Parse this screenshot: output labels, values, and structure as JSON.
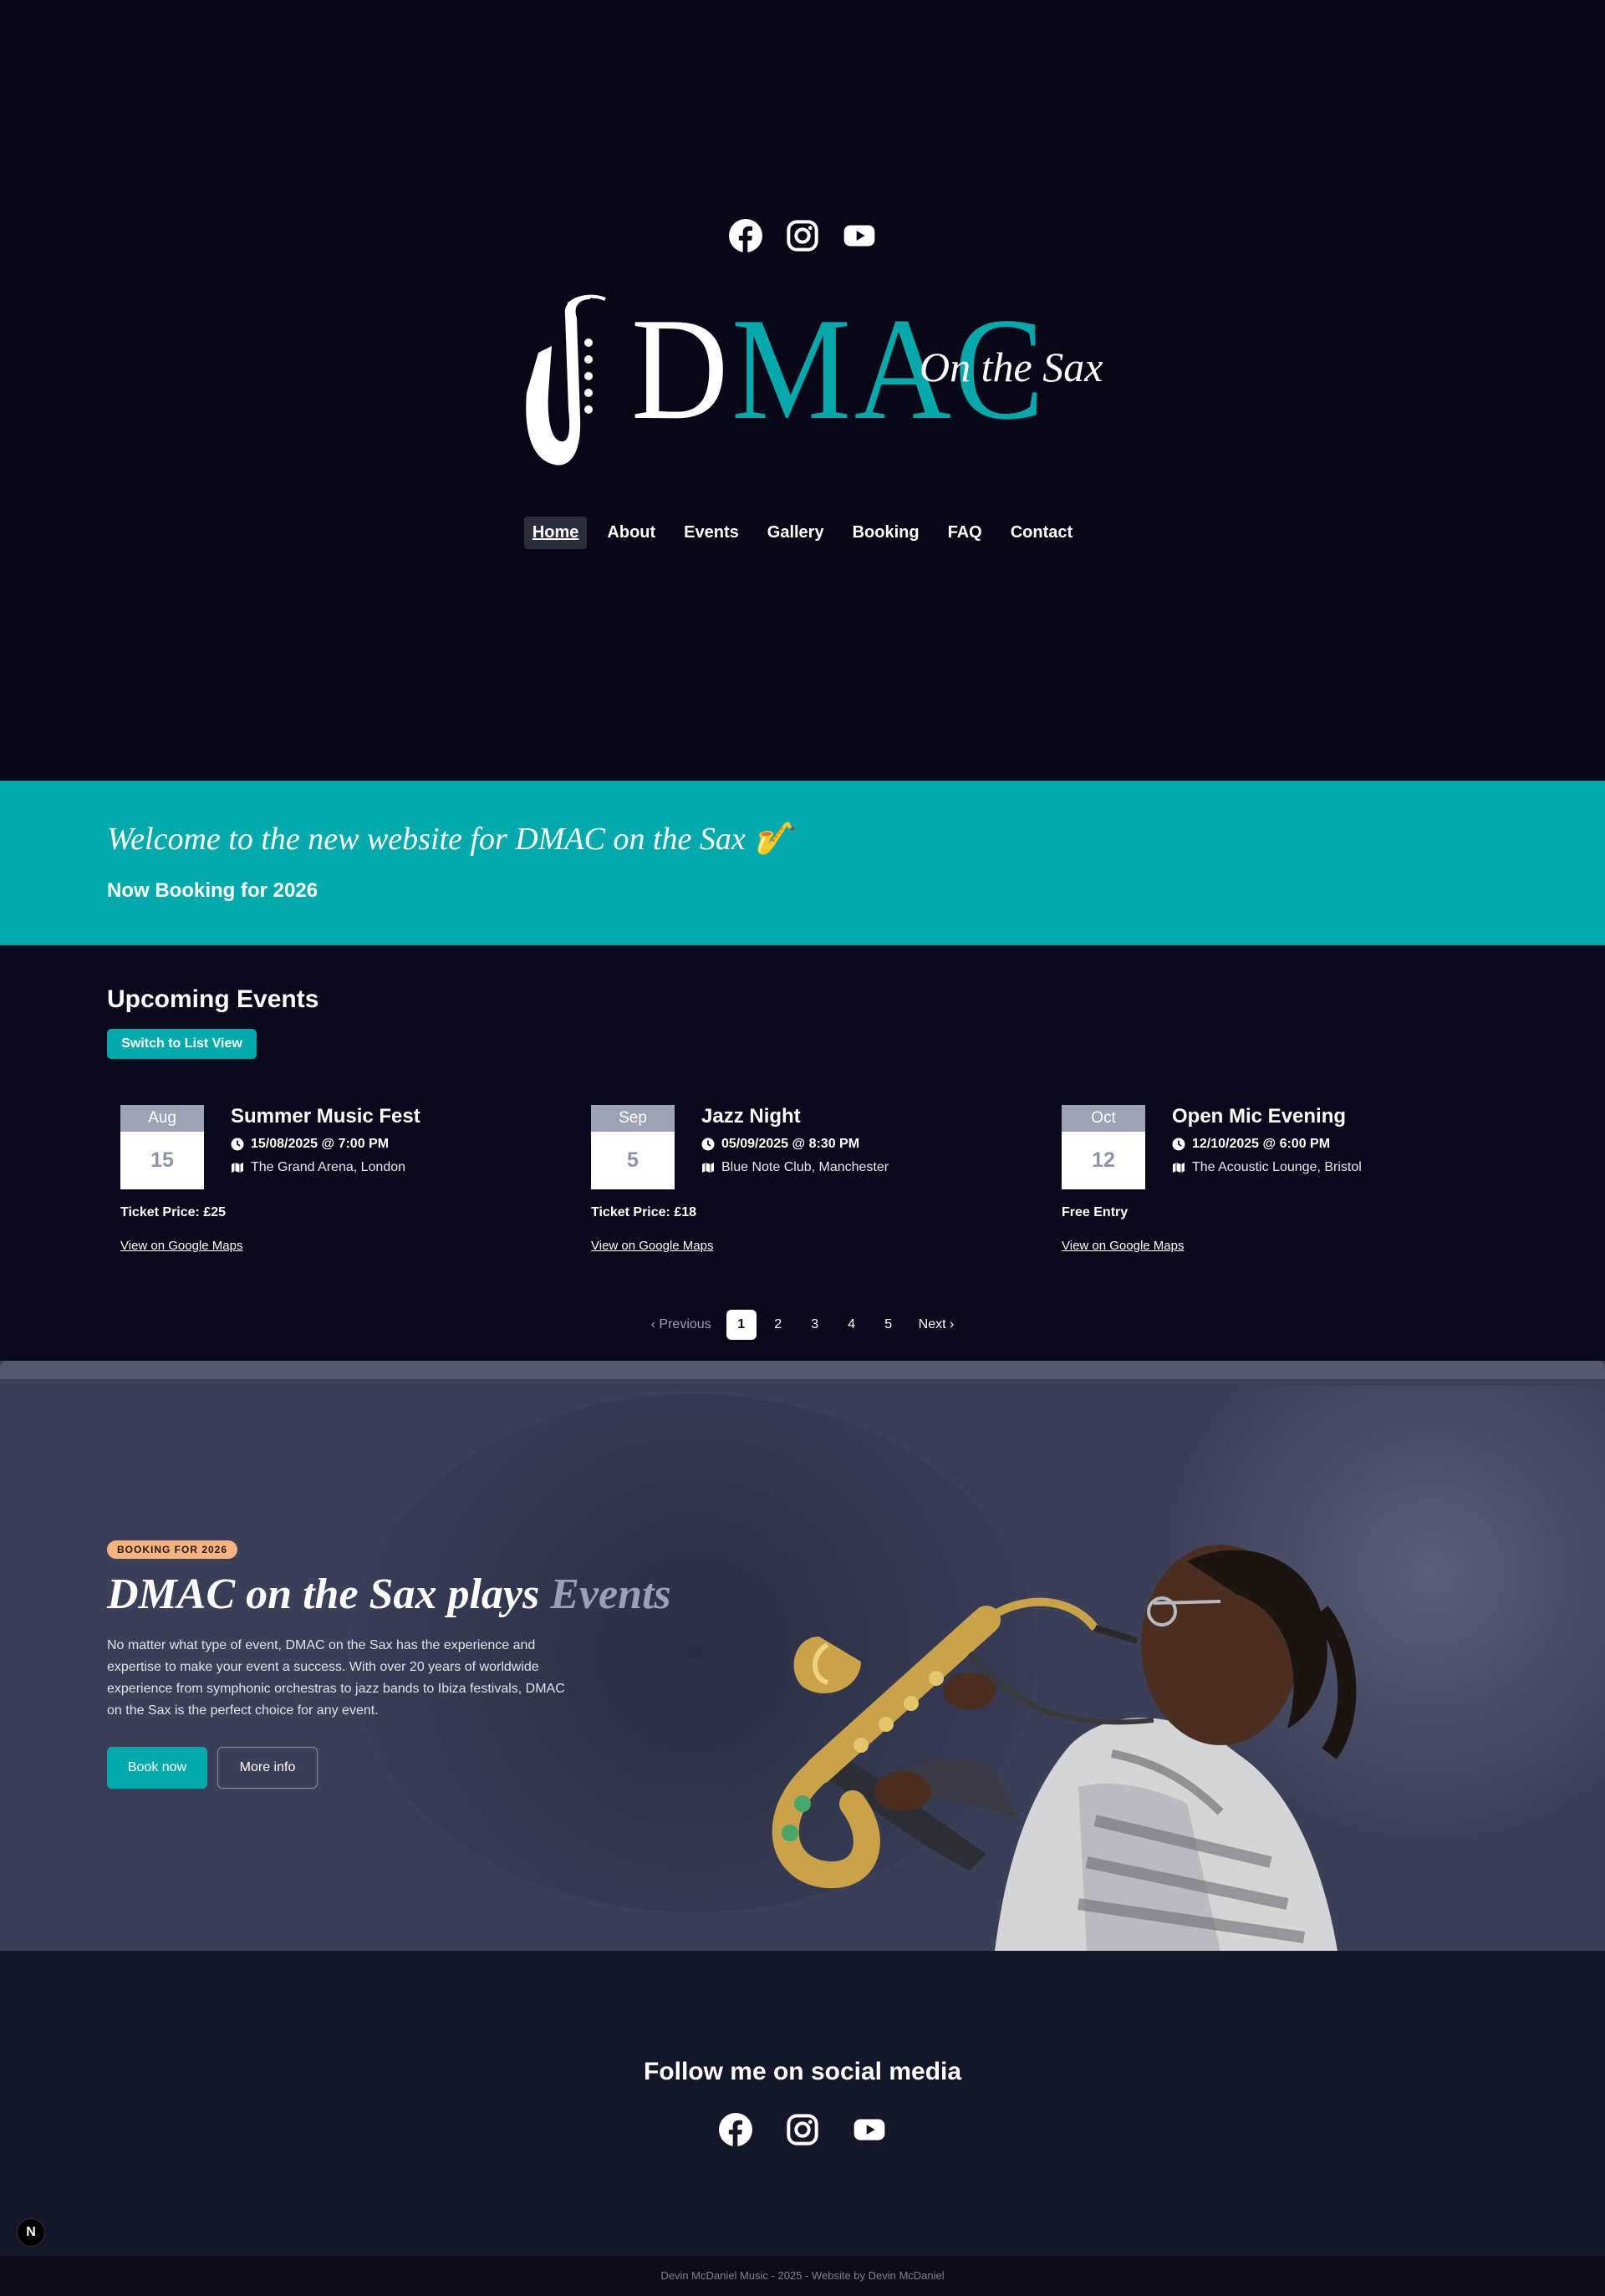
{
  "header": {
    "social": [
      {
        "icon": "facebook-icon"
      },
      {
        "icon": "instagram-icon"
      },
      {
        "icon": "youtube-icon"
      }
    ],
    "logo": {
      "first_letter": "D",
      "rest": "MAC",
      "tagline": "On the Sax"
    },
    "nav": [
      {
        "label": "Home",
        "active": true
      },
      {
        "label": "About"
      },
      {
        "label": "Events"
      },
      {
        "label": "Gallery"
      },
      {
        "label": "Booking"
      },
      {
        "label": "FAQ"
      },
      {
        "label": "Contact"
      }
    ]
  },
  "banner": {
    "title": "Welcome to the new website for DMAC on the Sax 🎷",
    "subtitle": "Now Booking for 2026"
  },
  "events": {
    "title": "Upcoming Events",
    "switch_label": "Switch to List View",
    "items": [
      {
        "month": "Aug",
        "day": "15",
        "name": "Summer Music Fest",
        "datetime": "15/08/2025 @ 7:00 PM",
        "venue": "The Grand Arena, London",
        "price": "Ticket Price: £25",
        "map": "View on Google Maps"
      },
      {
        "month": "Sep",
        "day": "5",
        "name": "Jazz Night",
        "datetime": "05/09/2025 @ 8:30 PM",
        "venue": "Blue Note Club, Manchester",
        "price": "Ticket Price: £18",
        "map": "View on Google Maps"
      },
      {
        "month": "Oct",
        "day": "12",
        "name": "Open Mic Evening",
        "datetime": "12/10/2025 @ 6:00 PM",
        "venue": "The Acoustic Lounge, Bristol",
        "price": "Free Entry",
        "map": "View on Google Maps"
      }
    ],
    "pagination": {
      "prev": "Previous",
      "pages": [
        "1",
        "2",
        "3",
        "4",
        "5"
      ],
      "current": "1",
      "next": "Next"
    }
  },
  "hero": {
    "badge": "BOOKING FOR 2026",
    "title_main": "DMAC on the Sax plays",
    "title_accent": "Events",
    "text": "No matter what type of event, DMAC on the Sax has the experience and expertise to make your event a success. With over 20 years of worldwide experience from symphonic orchestras to jazz bands to Ibiza festivals, DMAC on the Sax is the perfect choice for any event.",
    "book_label": "Book now",
    "more_label": "More info"
  },
  "follow": {
    "title": "Follow me on social media",
    "social": [
      {
        "icon": "facebook-icon"
      },
      {
        "icon": "instagram-icon"
      },
      {
        "icon": "youtube-icon"
      }
    ],
    "badge": "N"
  },
  "footer": {
    "text": "Devin McDaniel Music - 2025 - Website by Devin McDaniel"
  },
  "colors": {
    "accent": "#04aaab",
    "background": "#060815",
    "badge": "#f5b481"
  }
}
